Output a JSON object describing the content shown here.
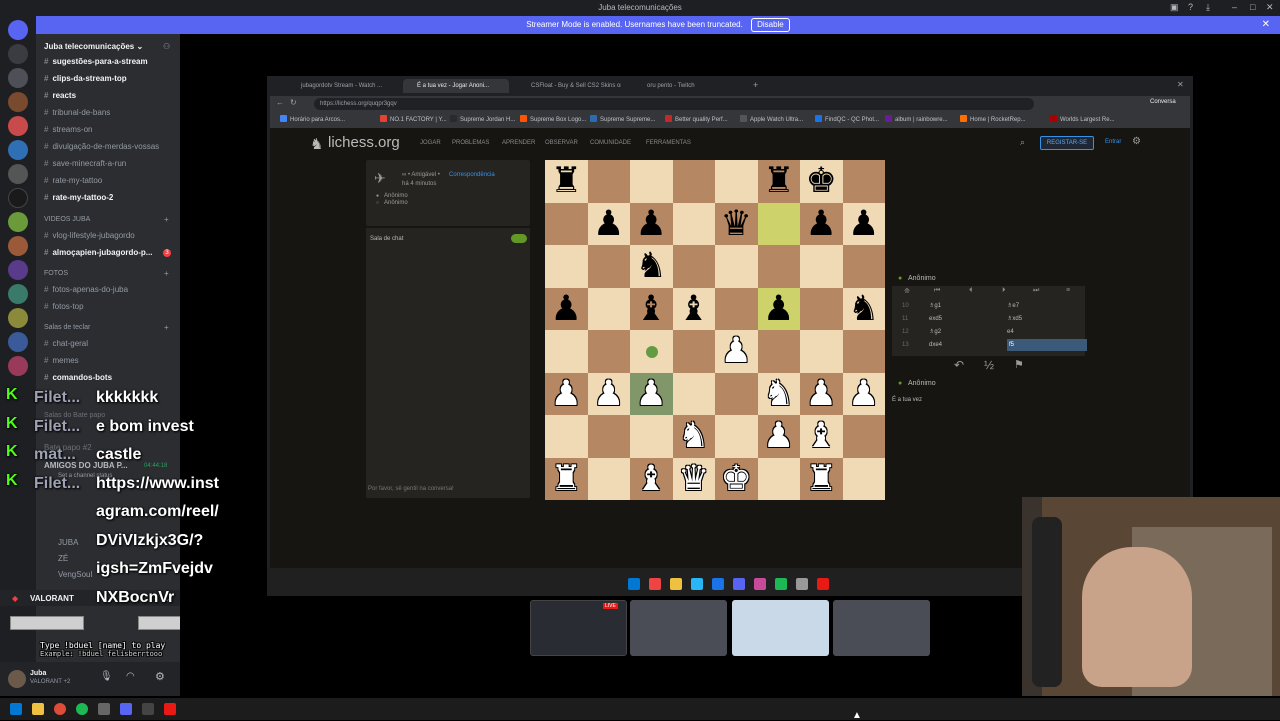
{
  "window": {
    "title": "Juba telecomunicações"
  },
  "streamer_banner": {
    "text": "Streamer Mode is enabled. Usernames have been truncated.",
    "disable_label": "Disable",
    "close": "✕"
  },
  "server": {
    "name": "Juba telecomunicações ⌄"
  },
  "channels": [
    {
      "name": "sugestões-para-a-stream",
      "bold": true
    },
    {
      "name": "clips-da-stream-top",
      "bold": true
    },
    {
      "name": "reacts",
      "bold": true
    },
    {
      "name": "tribunal-de-bans",
      "bold": false
    },
    {
      "name": "streams-on",
      "bold": false
    },
    {
      "name": "divulgação-de-merdas-vossas",
      "bold": false
    },
    {
      "name": "save-minecraft-a-run",
      "bold": false
    },
    {
      "name": "rate-my-tattoo",
      "bold": false
    },
    {
      "name": "rate-my-tattoo-2",
      "bold": true
    }
  ],
  "categories": {
    "videos": "VIDEOS JUBA",
    "fotos": "FOTOS",
    "salas": "Salas de teclar",
    "bate_papo": "Salas do Bate papo"
  },
  "videos_channels": [
    {
      "name": "vlog-lifestyle-jubagordo",
      "bold": false
    },
    {
      "name": "almoçapien-jubagordo-p...",
      "bold": true,
      "badge": "3"
    }
  ],
  "fotos_channels": [
    {
      "name": "fotos-apenas-do-juba"
    },
    {
      "name": "fotos-top"
    }
  ],
  "salas_channels": [
    {
      "name": "chat-geral",
      "bold": false
    },
    {
      "name": "memes",
      "bold": false
    },
    {
      "name": "comandos-bots",
      "bold": true
    }
  ],
  "voice_channels": {
    "batepapo2": "Bate papo #2",
    "amigos": "AMIGOS DO JUBA P...",
    "timer": "04:44:18",
    "status": "Set a channel status",
    "juba": "JUBA",
    "ze": "ZÉ",
    "vengsoul": "VengSoul"
  },
  "activity": {
    "game": "VALORANT"
  },
  "user": {
    "name": "Juba",
    "status": "VALORANT +2"
  },
  "browser": {
    "tabs": [
      "jubagordotv Stream - Watch ...",
      "É a tua vez - Jogar Anoni...",
      "CSFloat - Buy & Sell CS2 Skins on ...",
      "oru pento - Twitch"
    ],
    "url": "https://lichess.org/quqpr3gqv",
    "bookmarks": [
      "Horário para Arcos...",
      "NO.1 FACTORY | Y...",
      "Supreme Jordan H...",
      "Supreme Box Logo...",
      "Supreme Supreme...",
      "Better quality Perf...",
      "Apple Watch Ultra...",
      "FindQC - QC Phot...",
      "album | rainbowre...",
      "Home | RocketRep...",
      "Worlds Largest Re..."
    ],
    "profile": "Conversa"
  },
  "lichess": {
    "logo": "lichess.org",
    "nav": [
      "JOGAR",
      "PROBLEMAS",
      "APRENDER",
      "OBSERVAR",
      "COMUNIDADE",
      "FERRAMENTAS"
    ],
    "signup": "REGISTAR-SE",
    "signin": "Entrar",
    "game_type": "∞ • Amigável • ",
    "game_mode": "Correspondência",
    "game_time": "há 4 minutos",
    "player1": "Anônimo",
    "player2": "Anônimo",
    "chat_title": "Sala de chat",
    "chat_placeholder": "Por favor, sê gentil na conversa!",
    "top_player": "Anônimo",
    "bottom_player": "Anônimo",
    "your_turn": "É a tua vez",
    "draw": "½",
    "moves": [
      {
        "n": "10",
        "w": "♗g1",
        "b": "♗e7"
      },
      {
        "n": "11",
        "w": "exd5",
        "b": "♗xd5"
      },
      {
        "n": "12",
        "w": "♗g2",
        "b": "e4"
      },
      {
        "n": "13",
        "w": "dxe4",
        "b": "f5"
      }
    ]
  },
  "board": {
    "rows": [
      [
        "r",
        "",
        "",
        "",
        "",
        "r",
        "k",
        ""
      ],
      [
        "",
        "p",
        "p",
        "",
        "q",
        "",
        "p",
        "p"
      ],
      [
        "",
        "",
        "n",
        "",
        "",
        "",
        "",
        ""
      ],
      [
        "p",
        "",
        "b",
        "b",
        "",
        "p",
        "",
        "n"
      ],
      [
        "",
        "",
        "",
        "",
        "P",
        "",
        "",
        ""
      ],
      [
        "P",
        "P",
        "P",
        "",
        "",
        "N",
        "P",
        "P"
      ],
      [
        "",
        "",
        "",
        "N",
        "",
        "P",
        "B",
        ""
      ],
      [
        "R",
        "",
        "B",
        "Q",
        "K",
        "",
        "R",
        ""
      ]
    ],
    "highlights": [
      [
        1,
        5
      ],
      [
        3,
        5
      ]
    ],
    "selected": [
      5,
      2
    ]
  },
  "chat_overlay": [
    {
      "name": "Filet...",
      "msg": "kkkkkkk"
    },
    {
      "name": "Filet...",
      "msg": "e bom invest"
    },
    {
      "name": "mat...",
      "msg": "castle"
    },
    {
      "name": "Filet...",
      "msg": "https://www.inst"
    },
    {
      "name": "",
      "msg": "agram.com/reel/"
    },
    {
      "name": "",
      "msg": "DViVIzkjx3G/?"
    },
    {
      "name": "",
      "msg": "igsh=ZmFvejdv"
    },
    {
      "name": "",
      "msg": "NXBocnVr"
    }
  ],
  "duel": {
    "line1": "Type !bduel [name] to play",
    "line2": "Example: !bduel felisberrtooo"
  },
  "colors": {
    "discord_blurple": "#5865f2",
    "kick_green": "#53fc18",
    "lichess_blue": "#3692e7"
  }
}
